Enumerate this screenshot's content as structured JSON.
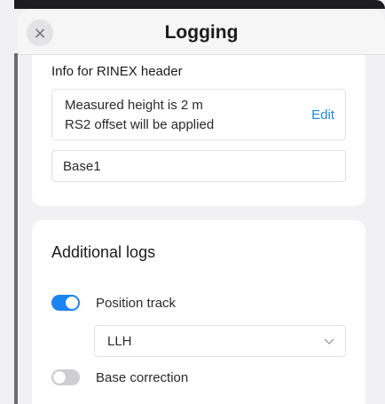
{
  "header": {
    "title": "Logging",
    "close_icon": "×"
  },
  "rinex": {
    "section_label": "Info for RINEX header",
    "height_line": "Measured height is 2 m",
    "offset_line": "RS2 offset will be applied",
    "edit_label": "Edit",
    "marker_name": "Base1"
  },
  "additional_logs": {
    "heading": "Additional logs",
    "position_track": {
      "label": "Position track",
      "enabled": true,
      "format_selected": "LLH"
    },
    "base_correction": {
      "label": "Base correction",
      "enabled": false
    }
  },
  "colors": {
    "accent": "#1a84f0",
    "link": "#1e88e5",
    "toggle_off": "#cfcfd2"
  },
  "icons": {
    "close": "close-icon",
    "dropdown": "chevron-down-icon"
  }
}
